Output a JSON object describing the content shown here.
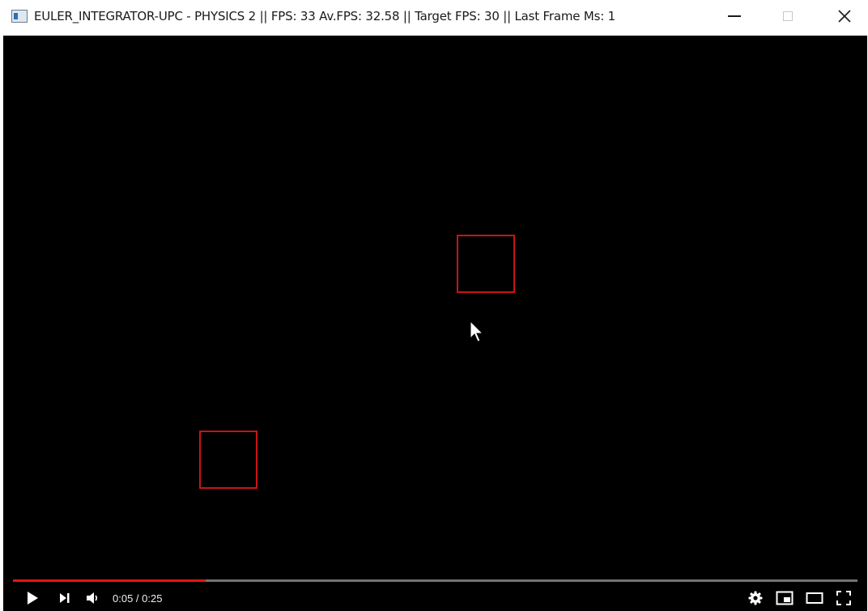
{
  "window": {
    "title": "EULER_INTEGRATOR-UPC - PHYSICS 2 || FPS: 33 Av.FPS: 32.58 || Target FPS: 30 || Last Frame Ms: 1",
    "app_icon": "application-window-icon",
    "controls": [
      "minimize-icon",
      "maximize-icon",
      "close-icon"
    ]
  },
  "scene": {
    "background": "#000000",
    "box_color": "#c81414",
    "objects": [
      {
        "name": "physics-box-upper"
      },
      {
        "name": "physics-box-lower"
      }
    ],
    "cursor_icon": "mouse-pointer-icon"
  },
  "player": {
    "current_time": "0:05",
    "duration": "0:25",
    "time_text": "0:05 / 0:25",
    "progress_fraction": 0.228,
    "progress_color": "#e01515",
    "buttons": [
      "play-icon",
      "next-icon",
      "volume-icon",
      "settings-icon",
      "miniplayer-icon",
      "theater-mode-icon",
      "fullscreen-icon"
    ]
  }
}
